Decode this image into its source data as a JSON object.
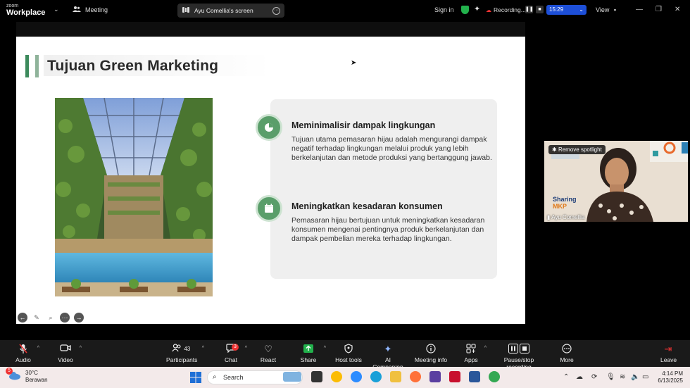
{
  "topbar": {
    "brand_line1": "zoom",
    "brand_line2": "Workplace",
    "meeting_label": "Meeting",
    "share_label": "Ayu Comellia's screen",
    "signin_label": "Sign in",
    "recording_label": "Recording...",
    "timer": "15:29",
    "view_label": "View"
  },
  "slide": {
    "title": "Tujuan Green Marketing",
    "points": [
      {
        "heading": "Meminimalisir dampak lingkungan",
        "body": "Tujuan utama pemasaran hijau adalah mengurangi dampak negatif terhadap lingkungan melalui produk yang lebih berkelanjutan dan metode produksi yang bertanggung jawab."
      },
      {
        "heading": "Meningkatkan kesadaran konsumen",
        "body": "Pemasaran hijau bertujuan untuk meningkatkan kesadaran konsumen mengenai pentingnya produk berkelanjutan dan dampak pembelian mereka terhadap lingkungan."
      }
    ]
  },
  "video": {
    "spotlight_label": "Remove spotlight",
    "participant_name": "Ayu Comellia",
    "bg_text1": "Sharing",
    "bg_text2": "MKP"
  },
  "toolbar": {
    "audio": "Audio",
    "video": "Video",
    "participants": "Participants",
    "participants_count": "43",
    "chat": "Chat",
    "chat_badge": "3",
    "react": "React",
    "share": "Share",
    "host_tools": "Host tools",
    "ai_companion": "AI Companion",
    "meeting_info": "Meeting info",
    "apps": "Apps",
    "pause_stop": "Pause/stop recording",
    "more": "More",
    "leave": "Leave"
  },
  "taskbar": {
    "weather_temp": "30°C",
    "weather_desc": "Berawan",
    "weather_badge": "5",
    "search_placeholder": "Search",
    "time": "4:14 PM",
    "date": "6/13/2025"
  },
  "colors": {
    "accent_green": "#3c8a5c",
    "icon_green": "#5a9e6a",
    "timer_blue": "#1d4fd8",
    "recording_red": "#e33333",
    "shield_green": "#22b14c"
  }
}
